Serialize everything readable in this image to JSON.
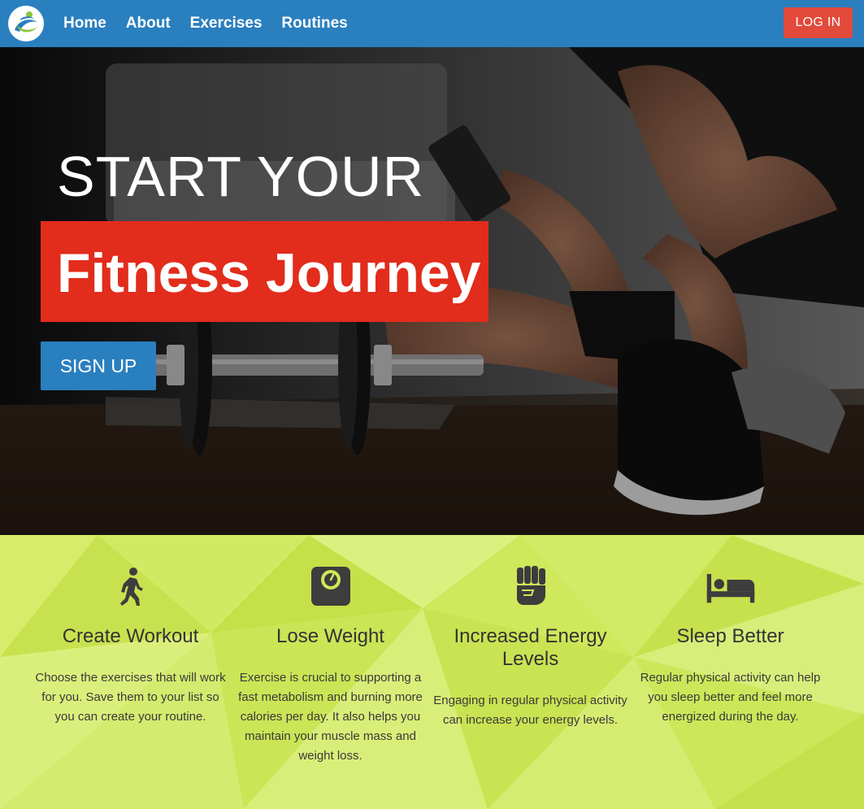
{
  "nav": {
    "logo_icon": "runner-logo-icon",
    "links": [
      "Home",
      "About",
      "Exercises",
      "Routines"
    ],
    "login_label": "LOG IN"
  },
  "hero": {
    "line1": "START YOUR",
    "line2": "Fitness Journey",
    "signup_label": "SIGN UP"
  },
  "features": [
    {
      "icon": "walking-person-icon",
      "title": "Create Workout",
      "text": "Choose the exercises that will work for you. Save them to your list so you can create your routine."
    },
    {
      "icon": "weight-scale-icon",
      "title": "Lose Weight",
      "text": "Exercise is crucial to supporting a fast metabolism and burning more calories per day. It also helps you maintain your muscle mass and weight loss."
    },
    {
      "icon": "fist-icon",
      "title": "Increased Energy Levels",
      "text": "Engaging in regular physical activity can increase your energy levels."
    },
    {
      "icon": "bed-icon",
      "title": "Sleep Better",
      "text": "Regular physical activity can help you sleep better and feel more energized during the day."
    }
  ],
  "colors": {
    "nav_bg": "#2a7fbf",
    "login_bg": "#e24a3b",
    "hero_accent": "#e22c1c",
    "features_bg": "#cfe85a"
  }
}
